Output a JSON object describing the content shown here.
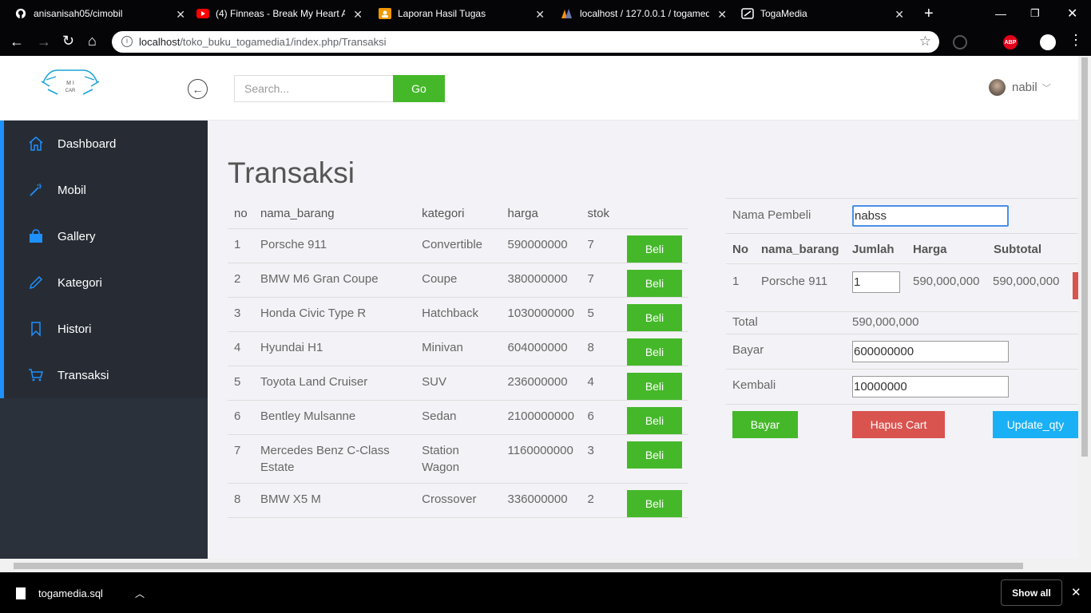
{
  "browser": {
    "tabs": [
      {
        "title": "anisanisah05/cimobil",
        "icon": "github-icon"
      },
      {
        "title": "(4) Finneas - Break My Heart A",
        "icon": "youtube-icon"
      },
      {
        "title": "Laporan Hasil Tugas",
        "icon": "classroom-icon"
      },
      {
        "title": "localhost / 127.0.0.1 / togamed",
        "icon": "phpmyadmin-icon"
      },
      {
        "title": "TogaMedia",
        "icon": "page-icon"
      }
    ],
    "url_host": "localhost",
    "url_path": "/toko_buku_togamedia1/index.php/Transaksi",
    "abp_badge": "ABP"
  },
  "header": {
    "logo_text_top": "M I",
    "logo_text_bottom": "CAR",
    "search_placeholder": "Search...",
    "go_label": "Go",
    "user_name": "nabil"
  },
  "sidebar": {
    "items": [
      {
        "label": "Dashboard",
        "icon": "home-icon"
      },
      {
        "label": "Mobil",
        "icon": "magic-wand-icon"
      },
      {
        "label": "Gallery",
        "icon": "shopping-bag-icon"
      },
      {
        "label": "Kategori",
        "icon": "pencil-icon"
      },
      {
        "label": "Histori",
        "icon": "bookmark-icon"
      },
      {
        "label": "Transaksi",
        "icon": "cart-icon"
      }
    ]
  },
  "main": {
    "title": "Transaksi",
    "columns": [
      "no",
      "nama_barang",
      "kategori",
      "harga",
      "stok"
    ],
    "buy_label": "Beli",
    "products": [
      {
        "no": "1",
        "name": "Porsche 911",
        "category": "Convertible",
        "price": "590000000",
        "stock": "7"
      },
      {
        "no": "2",
        "name": "BMW M6 Gran Coupe",
        "category": "Coupe",
        "price": "380000000",
        "stock": "7"
      },
      {
        "no": "3",
        "name": "Honda Civic Type R",
        "category": "Hatchback",
        "price": "1030000000",
        "stock": "5"
      },
      {
        "no": "4",
        "name": "Hyundai H1",
        "category": "Minivan",
        "price": "604000000",
        "stock": "8"
      },
      {
        "no": "5",
        "name": "Toyota Land Cruiser",
        "category": "SUV",
        "price": "236000000",
        "stock": "4"
      },
      {
        "no": "6",
        "name": "Bentley Mulsanne",
        "category": "Sedan",
        "price": "2100000000",
        "stock": "6"
      },
      {
        "no": "7",
        "name": "Mercedes Benz C-Class Estate",
        "category": "Station Wagon",
        "price": "1160000000",
        "stock": "3"
      },
      {
        "no": "8",
        "name": "BMW X5 M",
        "category": "Crossover",
        "price": "336000000",
        "stock": "2"
      }
    ]
  },
  "cart": {
    "buyer_label": "Nama Pembeli",
    "buyer_value": "nabss",
    "columns": [
      "No",
      "nama_barang",
      "Jumlah",
      "Harga",
      "Subtotal"
    ],
    "items": [
      {
        "no": "1",
        "name": "Porsche 911",
        "qty": "1",
        "price": "590,000,000",
        "subtotal": "590,000,000"
      }
    ],
    "total_label": "Total",
    "total_value": "590,000,000",
    "pay_label": "Bayar",
    "pay_value": "600000000",
    "change_label": "Kembali",
    "change_value": "10000000",
    "btn_pay": "Bayar",
    "btn_clear": "Hapus Cart",
    "btn_update": "Update_qty"
  },
  "downloads": {
    "file": "togamedia.sql",
    "show_all": "Show all"
  },
  "colors": {
    "green": "#45b82a",
    "red": "#d9534f",
    "blue": "#1ab0f5",
    "sidebar_bg": "#2b313b",
    "accent": "#1e90ff"
  }
}
